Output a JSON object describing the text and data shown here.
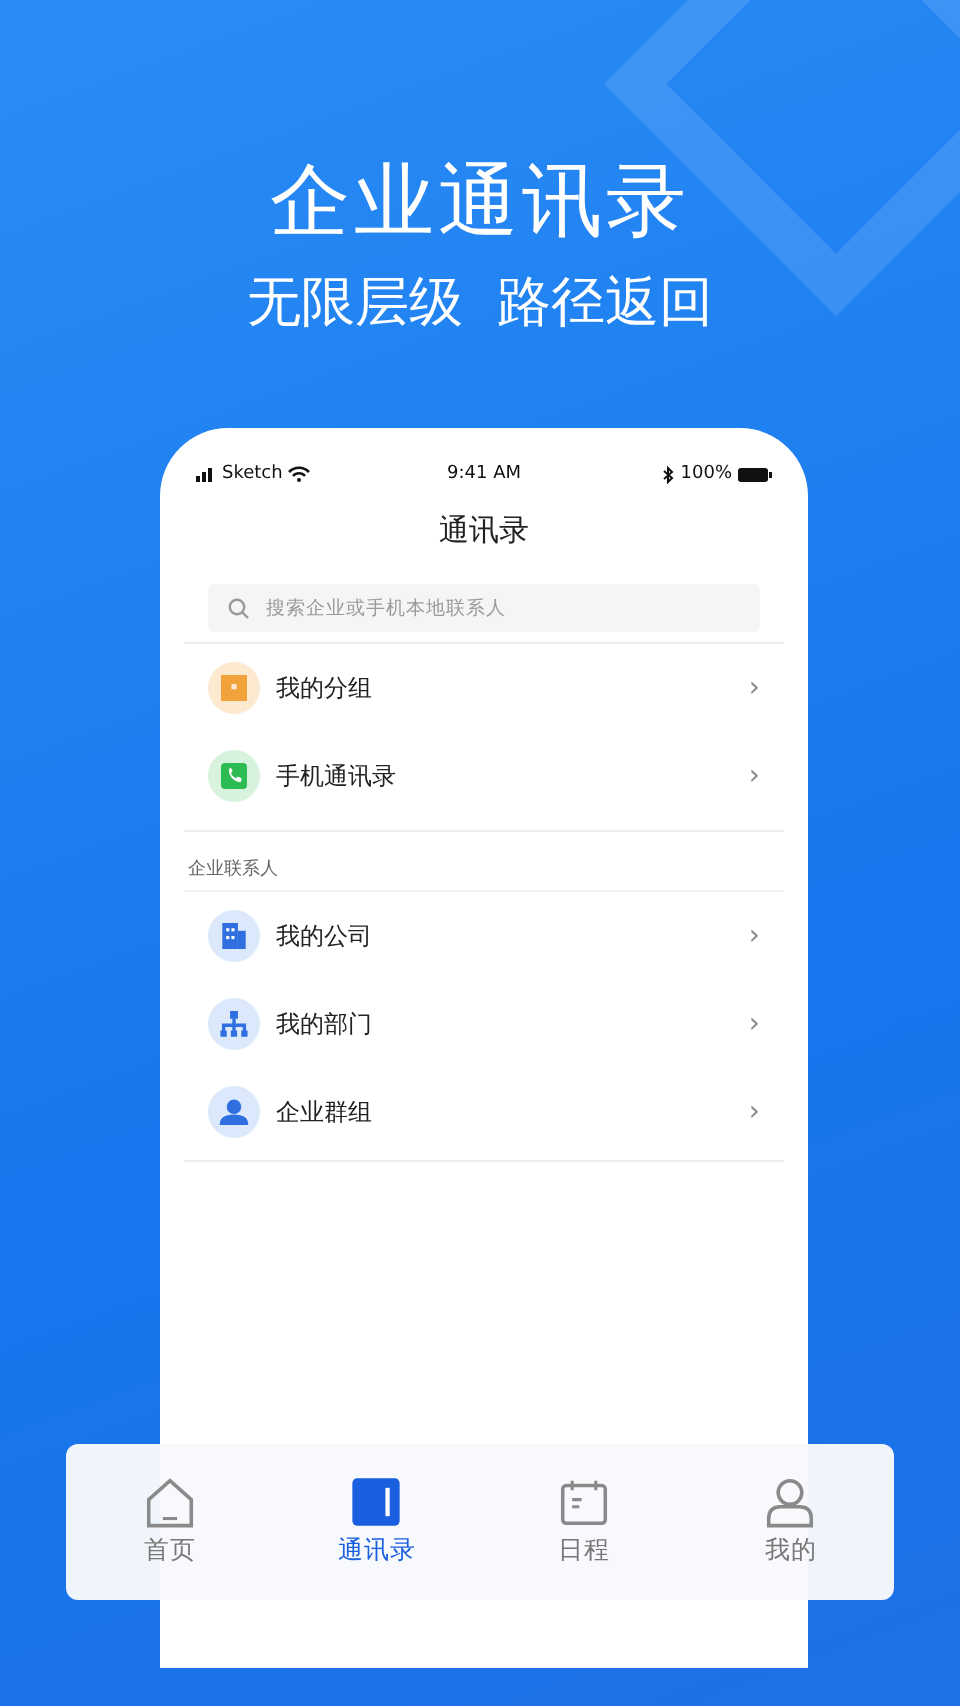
{
  "headline": "企业通讯录",
  "subheadline": "无限层级  路径返回",
  "status_bar": {
    "carrier": "Sketch",
    "time": "9:41 AM",
    "battery": "100%"
  },
  "screen_title": "通讯录",
  "search": {
    "placeholder": "搜索企业或手机本地联系人"
  },
  "sections": [
    {
      "items": [
        {
          "kind": "folder",
          "label": "我的分组"
        },
        {
          "kind": "phone",
          "label": "手机通讯录"
        }
      ]
    },
    {
      "header": "企业联系人",
      "items": [
        {
          "kind": "building",
          "label": "我的公司"
        },
        {
          "kind": "org",
          "label": "我的部门"
        },
        {
          "kind": "group",
          "label": "企业群组"
        }
      ]
    }
  ],
  "chevron": "›",
  "tab_bar": [
    {
      "kind": "home",
      "label": "首页",
      "selected": false
    },
    {
      "kind": "contacts",
      "label": "通讯录",
      "selected": true
    },
    {
      "kind": "calendar",
      "label": "日程",
      "selected": false
    },
    {
      "kind": "person",
      "label": "我的",
      "selected": false
    }
  ]
}
